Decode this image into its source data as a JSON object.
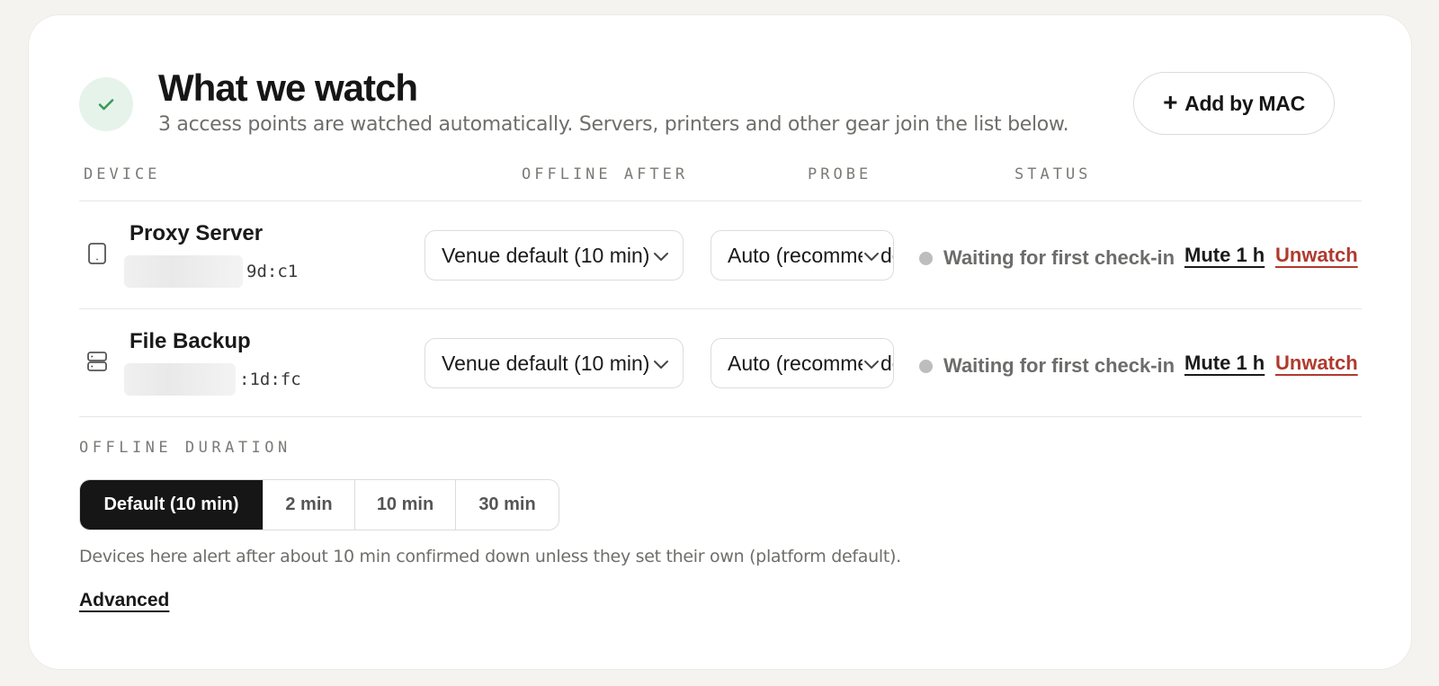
{
  "header": {
    "title": "What we watch",
    "subtitle": "3 access points are watched automatically. Servers, printers and other gear join the list below.",
    "status_icon": "check-icon",
    "add_button": {
      "icon": "plus-icon",
      "label": "Add by MAC"
    }
  },
  "columns": {
    "device": "DEVICE",
    "offline_after": "OFFLINE AFTER",
    "probe": "PROBE",
    "status": "STATUS"
  },
  "devices": [
    {
      "icon": "tablet-icon",
      "name": "Proxy Server",
      "mac_visible": "9d:c1",
      "offline_after": "Venue default (10 min)",
      "probe": "Auto (recommended)",
      "status": "Waiting for first check-in",
      "mute_label": "Mute 1 h",
      "unwatch_label": "Unwatch"
    },
    {
      "icon": "server-icon",
      "name": "File Backup",
      "mac_visible": ":1d:fc",
      "offline_after": "Venue default (10 min)",
      "probe": "Auto (recommended)",
      "status": "Waiting for first check-in",
      "mute_label": "Mute 1 h",
      "unwatch_label": "Unwatch"
    }
  ],
  "offline_duration": {
    "label": "OFFLINE DURATION",
    "options": [
      "Default (10 min)",
      "2 min",
      "10 min",
      "30 min"
    ],
    "selected": "Default (10 min)",
    "note": "Devices here alert after about 10 min confirmed down unless they set their own (platform default)."
  },
  "advanced_label": "Advanced",
  "colors": {
    "background": "#f4f3ef",
    "card": "#ffffff",
    "accent_check": "#3a9a5b",
    "check_bg": "#e6f3ea",
    "danger": "#b03a2e",
    "segment_active": "#161616",
    "status_dot": "#bdbdbb"
  }
}
